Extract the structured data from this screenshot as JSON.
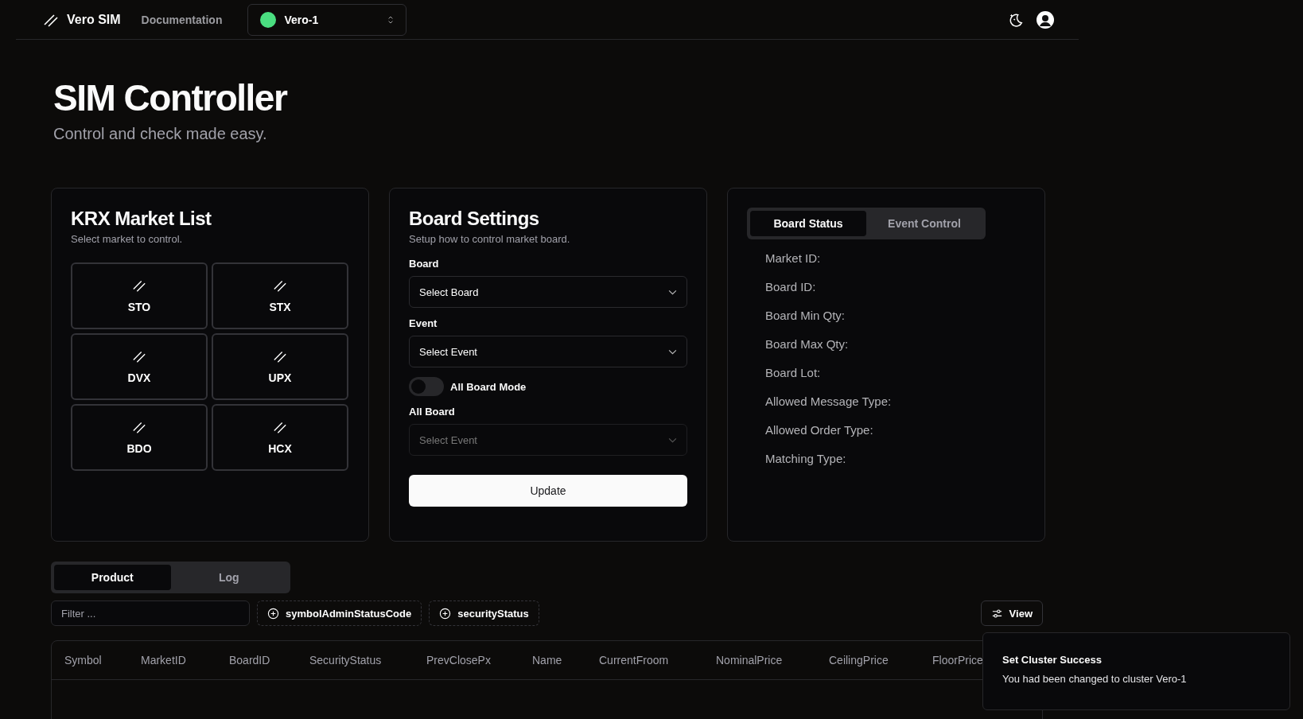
{
  "header": {
    "brand": "Vero SIM",
    "nav": [
      {
        "label": "Documentation"
      }
    ],
    "cluster": {
      "label": "Vero-1",
      "color": "#4ade80"
    }
  },
  "hero": {
    "title": "SIM Controller",
    "subtitle": "Control and check made easy."
  },
  "market_list": {
    "title": "KRX Market List",
    "subtitle": "Select market to control.",
    "markets": [
      {
        "label": "STO"
      },
      {
        "label": "STX"
      },
      {
        "label": "DVX"
      },
      {
        "label": "UPX"
      },
      {
        "label": "BDO"
      },
      {
        "label": "HCX"
      }
    ]
  },
  "board_settings": {
    "title": "Board Settings",
    "subtitle": "Setup how to control market board.",
    "controls": [
      {
        "kind": "select",
        "label": "Board",
        "placeholder": "Select Board",
        "disabled": false
      },
      {
        "kind": "select",
        "label": "Event",
        "placeholder": "Select Event",
        "disabled": false
      },
      {
        "kind": "toggle",
        "label": "All Board Mode",
        "on": false
      },
      {
        "kind": "select",
        "label": "All Board",
        "placeholder": "Select Event",
        "disabled": true
      }
    ],
    "button": "Update"
  },
  "status_panel": {
    "tabs": [
      {
        "label": "Board Status",
        "selected": true
      },
      {
        "label": "Event Control",
        "selected": false
      }
    ],
    "rows": [
      "Market ID:",
      "Board ID:",
      "Board Min Qty:",
      "Board Max Qty:",
      "Board Lot:",
      "Allowed Message Type:",
      "Allowed Order Type:",
      "Matching Type:"
    ]
  },
  "data_view": {
    "tabs": [
      {
        "label": "Product",
        "selected": true
      },
      {
        "label": "Log",
        "selected": false
      }
    ],
    "filter": {
      "placeholder": "Filter ..."
    },
    "facets": [
      "symbolAdminStatusCode",
      "securityStatus"
    ],
    "view_button": "View",
    "table": {
      "columns": [
        "Symbol",
        "MarketID",
        "BoardID",
        "SecurityStatus",
        "PrevClosePx",
        "Name",
        "CurrentFroom",
        "NominalPrice",
        "CeilingPrice",
        "FloorPrice"
      ]
    }
  },
  "toast": {
    "title": "Set Cluster Success",
    "message": "You had been changed to cluster Vero-1"
  }
}
